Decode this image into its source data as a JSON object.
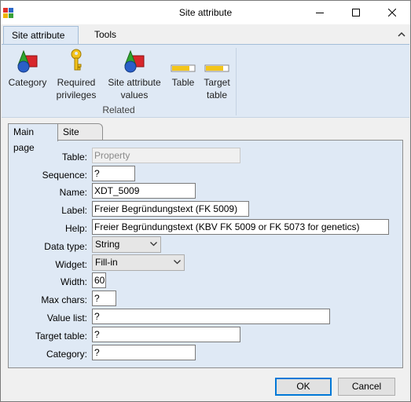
{
  "window": {
    "title": "Site attribute"
  },
  "ribbon": {
    "tabs": [
      {
        "label": "Site attribute"
      },
      {
        "label": "Tools"
      }
    ],
    "buttons": [
      {
        "label": "Category"
      },
      {
        "label": "Required privileges"
      },
      {
        "label": "Site attribute values"
      },
      {
        "label": "Table"
      },
      {
        "label": "Target table"
      }
    ],
    "buttons_lines": {
      "required_1": "Required",
      "required_2": "privileges",
      "values_1": "Site attribute",
      "values_2": "values",
      "target_1": "Target",
      "target_2": "table"
    },
    "group_label": "Related"
  },
  "page_tabs": [
    {
      "label": "Main page"
    },
    {
      "label": "Site attr."
    }
  ],
  "form": {
    "table": {
      "label": "Table:",
      "value": "Property"
    },
    "sequence": {
      "label": "Sequence:",
      "value": "?"
    },
    "name": {
      "label": "Name:",
      "value": "XDT_5009"
    },
    "label": {
      "label": "Label:",
      "value": "Freier Begründungstext (FK 5009)"
    },
    "help": {
      "label": "Help:",
      "value": "Freier Begründungstext (KBV FK 5009 or FK 5073 for genetics)"
    },
    "data_type": {
      "label": "Data type:",
      "value": "String"
    },
    "widget": {
      "label": "Widget:",
      "value": "Fill-in"
    },
    "width": {
      "label": "Width:",
      "value": "60"
    },
    "max_chars": {
      "label": "Max chars:",
      "value": "?"
    },
    "value_list": {
      "label": "Value list:",
      "value": "?"
    },
    "target_table": {
      "label": "Target table:",
      "value": "?"
    },
    "category": {
      "label": "Category:",
      "value": "?"
    }
  },
  "footer": {
    "ok_label": "OK",
    "cancel_label": "Cancel"
  },
  "icons": {
    "app": "app-icon",
    "minimize": "minimize-icon",
    "maximize": "maximize-icon",
    "close": "close-icon",
    "ribbon_collapse": "chevron-up-icon",
    "category": "shapes-icon",
    "privileges": "key-icon",
    "values": "shapes-icon",
    "table": "table-bar-icon",
    "target_table": "table-bar-icon"
  },
  "colors": {
    "ribbon_bg": "#dfe9f5",
    "default_button_border": "#0078d7"
  }
}
